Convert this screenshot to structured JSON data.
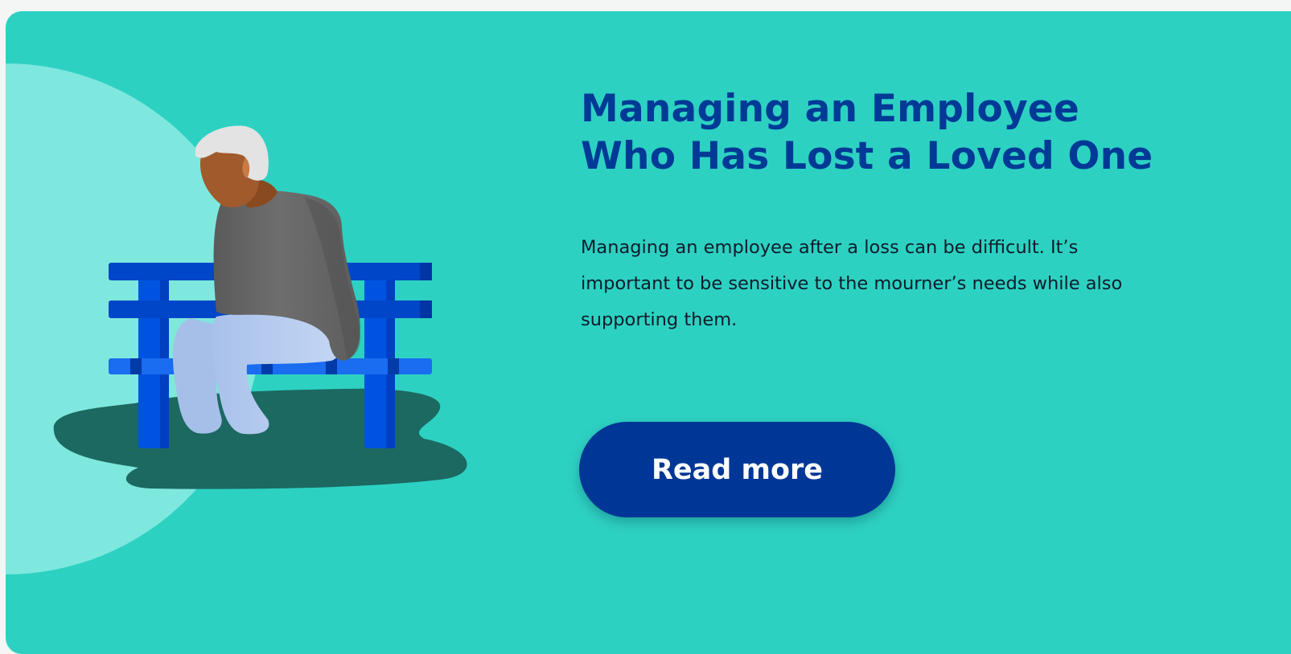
{
  "article": {
    "title_line1": "Managing an Employee",
    "title_line2": "Who Has Lost a Loved One",
    "description": "Managing an employee after a loss can be difficult. It’s important to be sensitive to the mourner’s needs while also supporting them.",
    "read_more_label": "Read more"
  },
  "colors": {
    "card_background": "#2dd1c2",
    "title": "#003a96",
    "button_background": "#003796",
    "button_text": "#ffffff"
  },
  "illustration": {
    "subject": "grieving man on park bench",
    "icon": "grieving-person-illustration"
  }
}
